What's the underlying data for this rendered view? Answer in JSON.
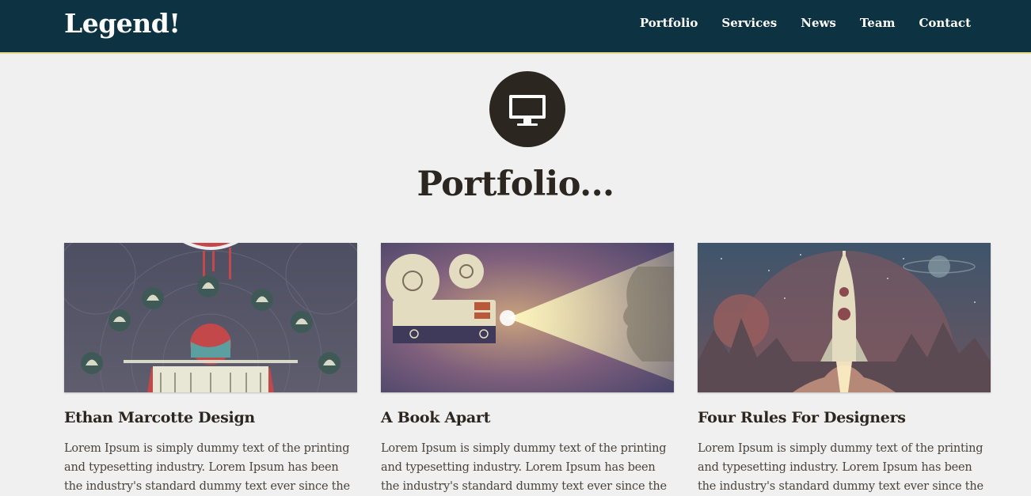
{
  "header": {
    "brand": "Legend!",
    "nav": [
      "Portfolio",
      "Services",
      "News",
      "Team",
      "Contact"
    ]
  },
  "hero": {
    "icon": "monitor-icon",
    "title": "Portfolio..."
  },
  "portfolio": [
    {
      "title": "Ethan Marcotte Design",
      "body": "Lorem Ipsum is simply dummy text of the printing and typesetting industry. Lorem Ipsum has been the industry's standard dummy text ever since the"
    },
    {
      "title": "A Book Apart",
      "body": "Lorem Ipsum is simply dummy text of the printing and typesetting industry. Lorem Ipsum has been the industry's standard dummy text ever since the"
    },
    {
      "title": "Four Rules For Designers",
      "body": "Lorem Ipsum is simply dummy text of the printing and typesetting industry. Lorem Ipsum has been the industry's standard dummy text ever since the"
    }
  ],
  "colors": {
    "navbar": "#0d3342",
    "accent_border": "#e8d98a",
    "background": "#f0f0f0",
    "text_dark": "#2c2620"
  }
}
